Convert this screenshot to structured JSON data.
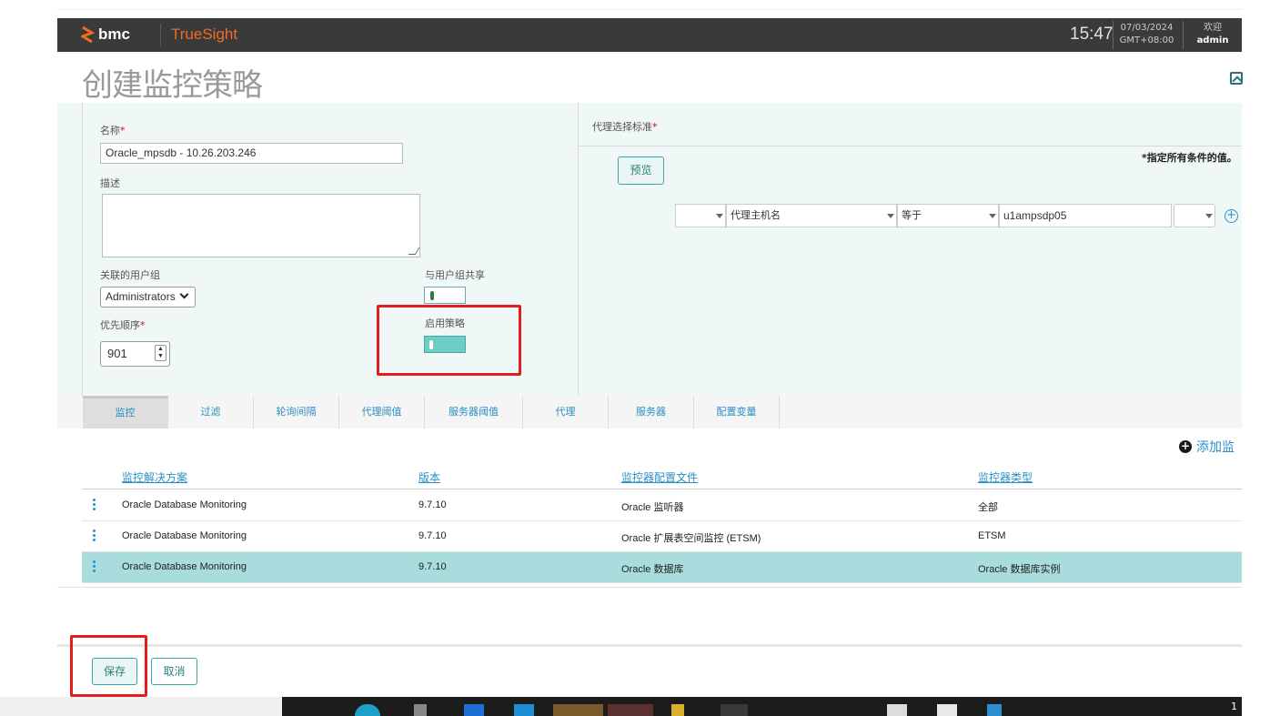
{
  "header": {
    "brand": "bmc",
    "product": "TrueSight",
    "time": "15:47",
    "date": "07/03/2024",
    "timezone": "GMT+08:00",
    "welcome": "欢迎",
    "user": "admin"
  },
  "page": {
    "title": "创建监控策略"
  },
  "form": {
    "name_label": "名称",
    "name_value": "Oracle_mpsdb - 10.26.203.246",
    "desc_label": "描述",
    "desc_value": "",
    "usergroup_label": "关联的用户组",
    "usergroup_value": "Administrators",
    "share_label": "与用户组共享",
    "share_state": "off",
    "priority_label": "优先顺序",
    "priority_value": "901",
    "enable_label": "启用策略",
    "enable_state": "on",
    "required_mark": "*"
  },
  "criteria": {
    "label": "代理选择标准",
    "preview_button": "预览",
    "hint": "*指定所有条件的值。",
    "field": "代理主机名",
    "operator": "等于",
    "value": "u1ampsdp05",
    "add_icon": "plus-circle-icon"
  },
  "tabs": [
    "监控",
    "过滤",
    "轮询间隔",
    "代理阈值",
    "服务器阈值",
    "代理",
    "服务器",
    "配置变量"
  ],
  "active_tab": "监控",
  "monitors": {
    "add_label": "添加监",
    "columns": [
      "监控解决方案",
      "版本",
      "监控器配置文件",
      "监控器类型"
    ],
    "rows": [
      {
        "solution": "Oracle Database Monitoring",
        "version": "9.7.10",
        "profile": "Oracle 监听器",
        "type": "全部",
        "selected": false
      },
      {
        "solution": "Oracle Database Monitoring",
        "version": "9.7.10",
        "profile": "Oracle 扩展表空间监控 (ETSM)",
        "type": "ETSM",
        "selected": false
      },
      {
        "solution": "Oracle Database Monitoring",
        "version": "9.7.10",
        "profile": "Oracle 数据库",
        "type": "Oracle 数据库实例",
        "selected": true
      }
    ]
  },
  "footer": {
    "save": "保存",
    "cancel": "取消"
  },
  "taskbar": {
    "edge_text": "1"
  },
  "colors": {
    "brand_orange": "#f26b21",
    "accent_teal": "#3aa6a0",
    "highlight_red": "#e11d1d",
    "link_blue": "#2b8fc6",
    "selected_row": "#a9dcdc"
  }
}
